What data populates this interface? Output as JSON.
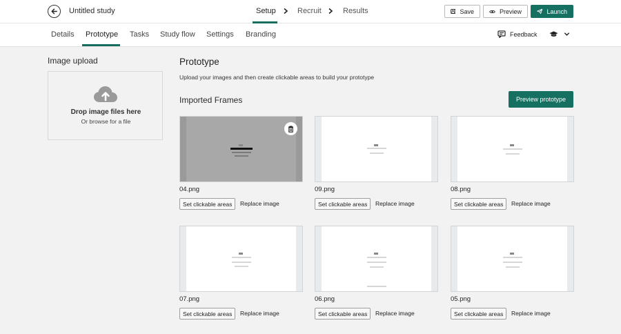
{
  "header": {
    "title": "Untitled study",
    "steps": [
      {
        "label": "Setup",
        "active": true
      },
      {
        "label": "Recruit",
        "active": false
      },
      {
        "label": "Results",
        "active": false
      }
    ],
    "save_label": "Save",
    "preview_label": "Preview",
    "launch_label": "Launch"
  },
  "subnav": {
    "tabs": [
      {
        "label": "Details",
        "active": false
      },
      {
        "label": "Prototype",
        "active": true
      },
      {
        "label": "Tasks",
        "active": false
      },
      {
        "label": "Study flow",
        "active": false
      },
      {
        "label": "Settings",
        "active": false
      },
      {
        "label": "Branding",
        "active": false
      }
    ],
    "feedback_label": "Feedback"
  },
  "upload": {
    "heading": "Image upload",
    "drop_title": "Drop image files here",
    "drop_sub": "Or browse for a file"
  },
  "prototype": {
    "title": "Prototype",
    "description": "Upload your images and then create clickable areas to build your prototype",
    "frames_heading": "Imported Frames",
    "preview_button": "Preview prototype",
    "set_clickable_label": "Set clickable areas",
    "replace_label": "Replace image",
    "frames": [
      {
        "name": "04.png",
        "selected": true
      },
      {
        "name": "09.png",
        "selected": false
      },
      {
        "name": "08.png",
        "selected": false
      },
      {
        "name": "07.png",
        "selected": false
      },
      {
        "name": "06.png",
        "selected": false
      },
      {
        "name": "05.png",
        "selected": false
      }
    ]
  },
  "colors": {
    "accent": "#157061",
    "background": "#f2f2f2"
  },
  "icons": [
    "arrow-left-icon",
    "chevron-right-icon",
    "save-icon",
    "eye-icon",
    "send-icon",
    "feedback-icon",
    "graduation-cap-icon",
    "chevron-down-icon",
    "cloud-upload-icon",
    "trash-icon"
  ]
}
